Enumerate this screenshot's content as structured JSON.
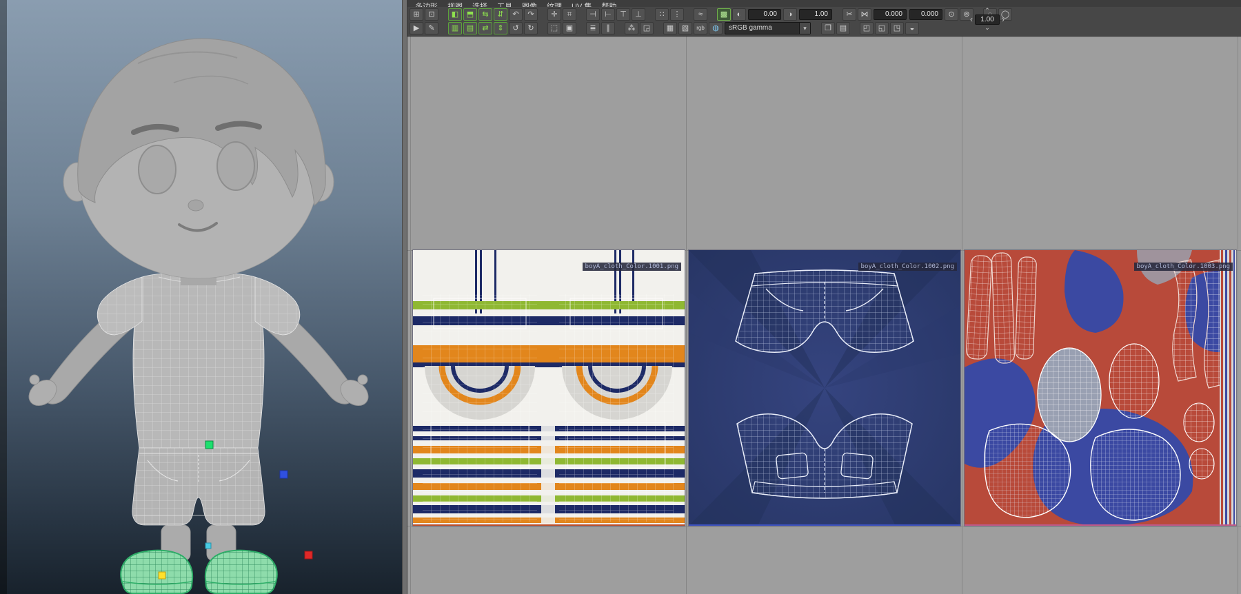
{
  "menus": {
    "items": [
      "多边形",
      "视图",
      "选择",
      "工具",
      "图像",
      "纹理",
      "UV 集",
      "帮助"
    ]
  },
  "toolbar": {
    "exposure": "0.00",
    "gamma": "1.00",
    "coord_u": "0.000",
    "coord_v": "0.000",
    "range_value": "1.00",
    "range_prev": "‹",
    "range_next": "›",
    "range_up": "⌃",
    "range_down": "⌄",
    "colorspace": "sRGB gamma",
    "row1": [
      {
        "name": "snap-together-icon",
        "glyph": "⊞"
      },
      {
        "name": "snap-point-icon",
        "glyph": "⊡"
      },
      {
        "type": "gap"
      },
      {
        "name": "flip-u-icon",
        "glyph": "◧",
        "green": true
      },
      {
        "name": "flip-v-icon",
        "glyph": "⬒",
        "green": true
      },
      {
        "name": "flip-shell-u-icon",
        "glyph": "⇆",
        "green": true
      },
      {
        "name": "flip-shell-v-icon",
        "glyph": "⇵",
        "green": true
      },
      {
        "name": "rotate-ccw-icon",
        "glyph": "↶"
      },
      {
        "name": "rotate-cw-icon",
        "glyph": "↷"
      },
      {
        "type": "gap"
      },
      {
        "name": "move-shell-icon",
        "glyph": "✛"
      },
      {
        "name": "snap-grid-icon",
        "glyph": "⌗"
      },
      {
        "type": "gap"
      },
      {
        "name": "align-u-min-icon",
        "glyph": "⊣"
      },
      {
        "name": "align-u-max-icon",
        "glyph": "⊢"
      },
      {
        "name": "align-v-max-icon",
        "glyph": "⊤"
      },
      {
        "name": "align-v-min-icon",
        "glyph": "⊥"
      },
      {
        "type": "gap"
      },
      {
        "name": "distribute-u-icon",
        "glyph": "∷"
      },
      {
        "name": "distribute-v-icon",
        "glyph": "⋮"
      },
      {
        "type": "gap"
      },
      {
        "name": "match-uvs-icon",
        "glyph": "≈"
      },
      {
        "type": "gap"
      },
      {
        "name": "checker-map-icon",
        "glyph": "▩",
        "active": true
      },
      {
        "name": "exposure-icon",
        "glyph": "◐"
      },
      {
        "type": "field",
        "name": "exposure-field",
        "bind": "exposure"
      },
      {
        "name": "gamma-icon",
        "glyph": "◑"
      },
      {
        "type": "field",
        "name": "gamma-field",
        "bind": "gamma"
      },
      {
        "type": "gap"
      },
      {
        "name": "cut-uv-icon",
        "glyph": "✂"
      },
      {
        "name": "sew-uv-icon",
        "glyph": "⋈"
      },
      {
        "type": "field",
        "name": "u-coordinate-field",
        "bind": "coord_u"
      },
      {
        "type": "field",
        "name": "v-coordinate-field",
        "bind": "coord_v"
      },
      {
        "name": "pin-uv-icon",
        "glyph": "⊙"
      },
      {
        "name": "unpin-uv-icon",
        "glyph": "⊚"
      },
      {
        "type": "gap"
      },
      {
        "name": "shell-border-icon",
        "glyph": "◌"
      },
      {
        "name": "texture-borders-icon",
        "glyph": "◯"
      }
    ],
    "row2": [
      {
        "name": "select-tool-icon",
        "glyph": "▶"
      },
      {
        "name": "paint-select-icon",
        "glyph": "✎"
      },
      {
        "type": "gap"
      },
      {
        "name": "straighten-u-icon",
        "glyph": "▥",
        "green": true
      },
      {
        "name": "straighten-v-icon",
        "glyph": "▤",
        "green": true
      },
      {
        "name": "straighten-shell-icon",
        "glyph": "⇄",
        "green": true
      },
      {
        "name": "unfold-along-icon",
        "glyph": "⇕",
        "green": true
      },
      {
        "name": "rotate-left-icon",
        "glyph": "↺"
      },
      {
        "name": "rotate-right-icon",
        "glyph": "↻"
      },
      {
        "type": "gap"
      },
      {
        "name": "unfold-icon",
        "glyph": "⬚"
      },
      {
        "name": "layout-icon",
        "glyph": "▣"
      },
      {
        "type": "gap"
      },
      {
        "name": "stack-shells-icon",
        "glyph": "≣"
      },
      {
        "name": "orient-shells-icon",
        "glyph": "∥"
      },
      {
        "type": "gap"
      },
      {
        "name": "distribute-shells-icon",
        "glyph": "⁂"
      },
      {
        "name": "texel-density-icon",
        "glyph": "◲"
      },
      {
        "type": "gap"
      },
      {
        "name": "grid-display-icon",
        "glyph": "▦"
      },
      {
        "name": "image-dim-icon",
        "glyph": "▧"
      },
      {
        "name": "rgb-channels-icon",
        "glyph": "rgb",
        "text": true
      },
      {
        "name": "shaded-uv-icon",
        "glyph": "◍",
        "blue": true
      },
      {
        "type": "dropdown",
        "name": "colorspace-dropdown",
        "bind": "colorspace"
      },
      {
        "type": "gap"
      },
      {
        "name": "copy-uvs-icon",
        "glyph": "❐"
      },
      {
        "name": "paste-uvs-icon",
        "glyph": "▤"
      },
      {
        "type": "gap"
      },
      {
        "name": "isolate-select-icon",
        "glyph": "◰"
      },
      {
        "name": "add-to-isolate-icon",
        "glyph": "◱"
      },
      {
        "name": "remove-from-isolate-icon",
        "glyph": "◳"
      },
      {
        "name": "uv-distortion-icon",
        "glyph": "◒"
      }
    ]
  },
  "uv_editor": {
    "tiles": [
      {
        "label": "boyA_cloth_Color.1001.png"
      },
      {
        "label": "boyA_cloth_Color.1002.png"
      },
      {
        "label": "boyA_cloth_Color.1003.png"
      }
    ]
  },
  "viewport": {
    "manipulators": [
      "manipulator-green-handle",
      "manipulator-blue-handle",
      "manipulator-red-handle",
      "manipulator-cyan-handle",
      "manipulator-yellow-handle"
    ]
  },
  "colors": {
    "shirt_orange": "#e2861c",
    "shirt_green": "#8fb832",
    "shirt_navy": "#1d2a66",
    "denim_blue": "#2c3a72",
    "tile3_red": "#b84a3a",
    "tile3_blue": "#3b49a2",
    "shoe_green": "#2eae68",
    "toolbar_green_accent": "#8fe24e",
    "canvas_gray": "#9e9e9e"
  }
}
